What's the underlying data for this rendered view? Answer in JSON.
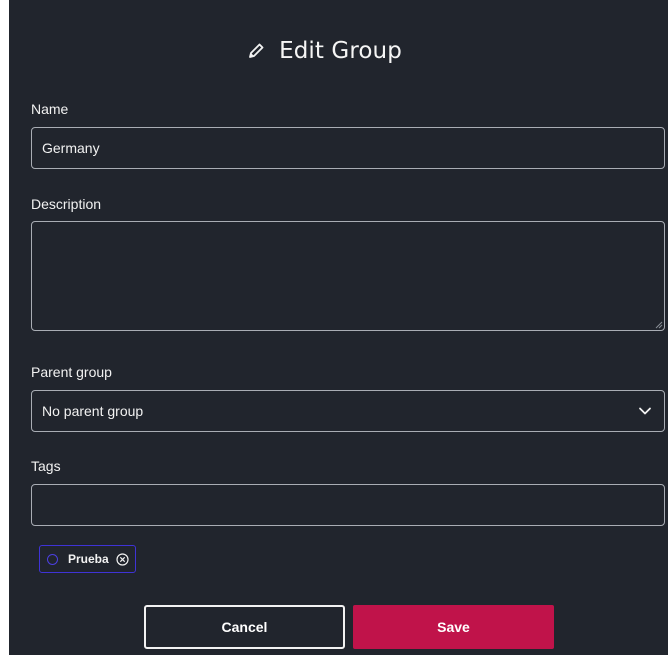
{
  "dialog": {
    "title": "Edit Group",
    "title_icon": "pencil-icon"
  },
  "form": {
    "name_label": "Name",
    "name_value": "Germany",
    "description_label": "Description",
    "description_value": "",
    "parent_label": "Parent group",
    "parent_value": "No parent group",
    "tags_label": "Tags",
    "tags_input_value": "",
    "tags": [
      {
        "label": "Prueba",
        "color": "#4b3fe0"
      }
    ]
  },
  "actions": {
    "cancel_label": "Cancel",
    "save_label": "Save"
  },
  "colors": {
    "background": "#21252d",
    "save_button": "#c0134a",
    "tag_accent": "#4b3fe0"
  }
}
